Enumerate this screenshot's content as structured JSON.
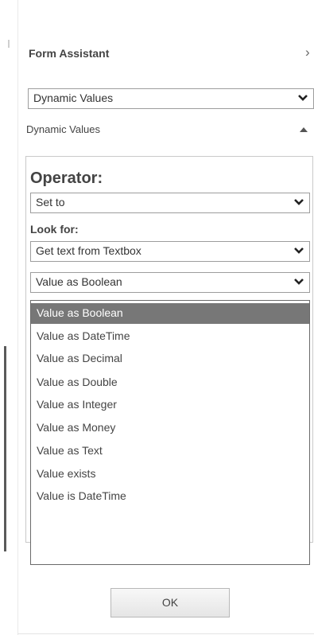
{
  "panel": {
    "title": "Form Assistant",
    "close_glyph": "›"
  },
  "top_select": {
    "value": "Dynamic Values"
  },
  "section": {
    "label": "Dynamic Values",
    "state": "expanded"
  },
  "operator": {
    "label": "Operator:",
    "value": "Set to"
  },
  "look_for": {
    "label": "Look for:",
    "source_value": "Get text from Textbox",
    "type_value": "Value as Boolean"
  },
  "type_options": [
    {
      "label": "Value as Boolean",
      "selected": true
    },
    {
      "label": "Value as DateTime",
      "selected": false
    },
    {
      "label": "Value as Decimal",
      "selected": false
    },
    {
      "label": "Value as Double",
      "selected": false
    },
    {
      "label": "Value as Integer",
      "selected": false
    },
    {
      "label": "Value as Money",
      "selected": false
    },
    {
      "label": "Value as Text",
      "selected": false
    },
    {
      "label": "Value exists",
      "selected": false
    },
    {
      "label": "Value is DateTime",
      "selected": false
    }
  ],
  "ok_button": {
    "label": "OK"
  },
  "icons": {
    "dropdown": "chevron-down-icon",
    "collapse": "triangle-up-icon"
  },
  "colors": {
    "selected_option_bg": "#777777",
    "selected_option_fg": "#ffffff"
  }
}
